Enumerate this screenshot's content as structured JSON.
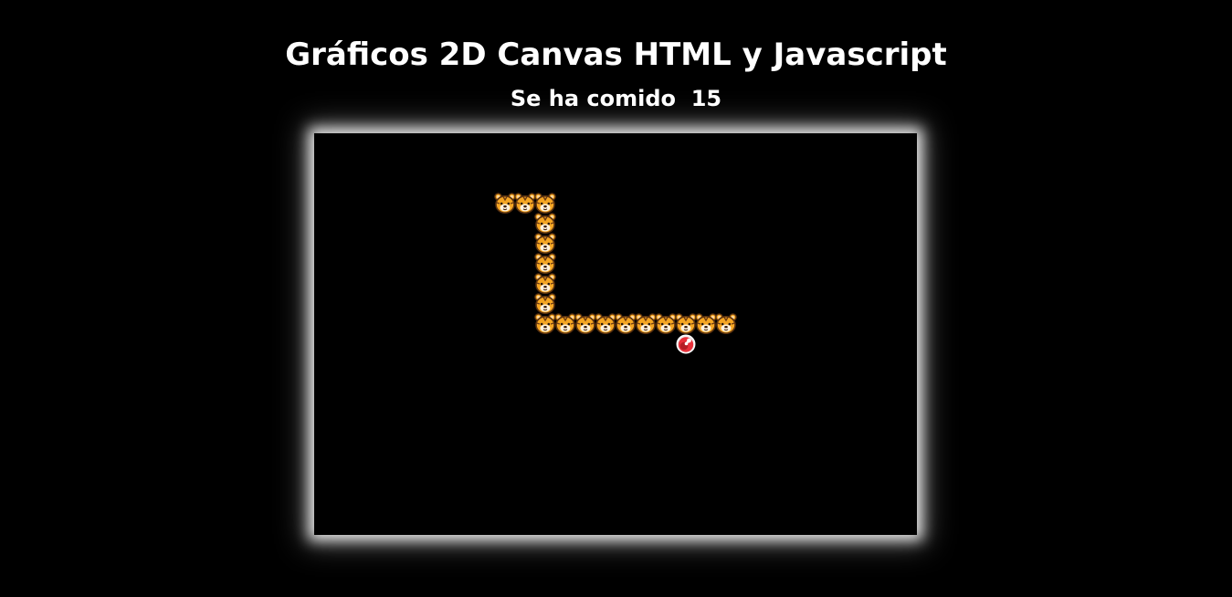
{
  "header": {
    "title": "Gráficos 2D Canvas HTML y Javascript",
    "score_label": "Se ha comido",
    "score_value": "15"
  },
  "game": {
    "snake_segment_icon": "tiger-face-icon",
    "food_icon": "meat-on-bone-icon",
    "snake": [
      {
        "col": 9,
        "row": 3
      },
      {
        "col": 10,
        "row": 3
      },
      {
        "col": 11,
        "row": 3
      },
      {
        "col": 11,
        "row": 4
      },
      {
        "col": 11,
        "row": 5
      },
      {
        "col": 11,
        "row": 6
      },
      {
        "col": 11,
        "row": 7
      },
      {
        "col": 11,
        "row": 8
      },
      {
        "col": 11,
        "row": 9
      },
      {
        "col": 12,
        "row": 9
      },
      {
        "col": 13,
        "row": 9
      },
      {
        "col": 14,
        "row": 9
      },
      {
        "col": 15,
        "row": 9
      },
      {
        "col": 16,
        "row": 9
      },
      {
        "col": 17,
        "row": 9
      },
      {
        "col": 18,
        "row": 9
      },
      {
        "col": 19,
        "row": 9
      },
      {
        "col": 20,
        "row": 9
      }
    ],
    "food": {
      "col": 18,
      "row": 10
    },
    "colors": {
      "board_background": "#000000",
      "board_glow": "#ffffff",
      "tiger_fur": "#f5a623",
      "tiger_stripe": "#6b3a12",
      "food_red": "#e8303a"
    }
  }
}
